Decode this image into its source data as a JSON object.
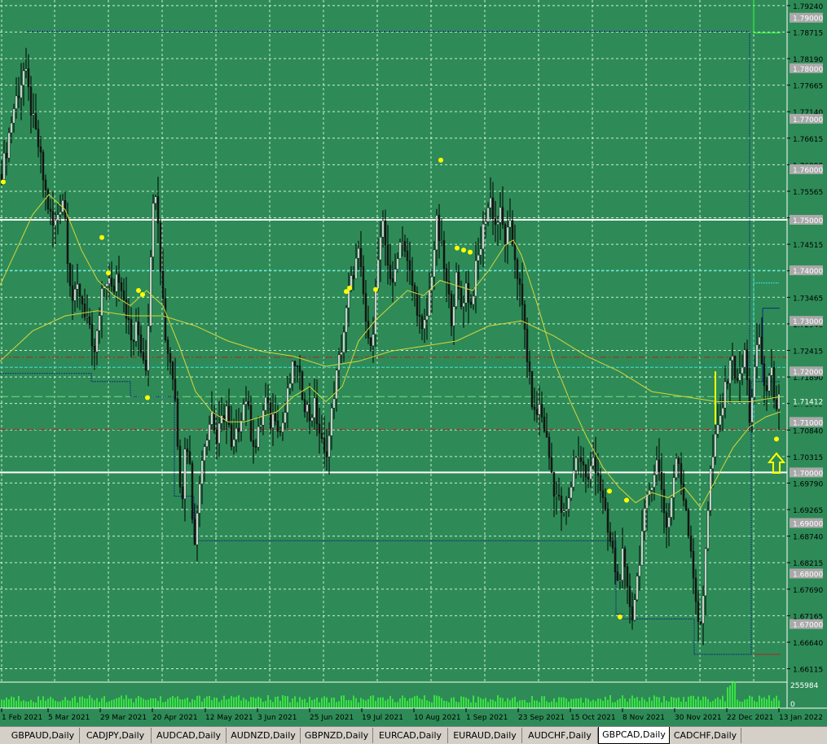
{
  "chart_data": {
    "type": "candlestick",
    "symbol_tab": "GBPCAD,Daily",
    "colors": {
      "background": "#2e8b57",
      "grid": "#e6ffe6",
      "bull_body": "#ffffff",
      "bear_body": "#1a1a1a",
      "wick": "#000000",
      "ma_fast": "#d6d63a",
      "ma_slow": "#d6d63a",
      "channel": "#102a7a",
      "level_white": "#ffffff",
      "level_red": "#b22222",
      "level_cyan": "#40e0e0",
      "fractal": "#ffff00",
      "volume": "#3cff3c",
      "axis_text": "#000000",
      "axis_box": "#a9a9a9"
    },
    "ylim": [
      1.6585,
      1.7935
    ],
    "y_ticks": [
      "1.79240",
      "1.78715",
      "1.78190",
      "1.77665",
      "1.77140",
      "1.76615",
      "1.76090",
      "1.75565",
      "1.75040",
      "1.74515",
      "1.73990",
      "1.73465",
      "1.72940",
      "1.72415",
      "1.71890",
      "1.71365",
      "1.70840",
      "1.70315",
      "1.69790",
      "1.69265",
      "1.68740",
      "1.68215",
      "1.67690",
      "1.67165",
      "1.66640",
      "1.66115"
    ],
    "round_levels": [
      "1.79000",
      "1.78000",
      "1.77000",
      "1.76000",
      "1.75000",
      "1.74000",
      "1.73000",
      "1.72000",
      "1.71000",
      "1.70000",
      "1.69000",
      "1.68000",
      "1.67000"
    ],
    "current_price": "1.71412",
    "volume_labels": [
      "255984",
      "0"
    ],
    "x_labels": [
      "1 Feb 2021",
      "5 Mar 2021",
      "29 Mar 2021",
      "20 Apr 2021",
      "12 May 2021",
      "3 Jun 2021",
      "25 Jun 2021",
      "19 Jul 2021",
      "10 Aug 2021",
      "1 Sep 2021",
      "23 Sep 2021",
      "15 Oct 2021",
      "8 Nov 2021",
      "30 Nov 2021",
      "22 Dec 2021",
      "13 Jan 2022"
    ],
    "close_path": [
      [
        0,
        1.759
      ],
      [
        6,
        1.762
      ],
      [
        12,
        1.768
      ],
      [
        18,
        1.773
      ],
      [
        24,
        1.776
      ],
      [
        30,
        1.78
      ],
      [
        36,
        1.774
      ],
      [
        42,
        1.768
      ],
      [
        48,
        1.764
      ],
      [
        54,
        1.757
      ],
      [
        60,
        1.752
      ],
      [
        66,
        1.748
      ],
      [
        72,
        1.752
      ],
      [
        78,
        1.755
      ],
      [
        84,
        1.741
      ],
      [
        90,
        1.733
      ],
      [
        96,
        1.737
      ],
      [
        102,
        1.733
      ],
      [
        108,
        1.73
      ],
      [
        114,
        1.722
      ],
      [
        120,
        1.728
      ],
      [
        126,
        1.736
      ],
      [
        132,
        1.739
      ],
      [
        138,
        1.735
      ],
      [
        144,
        1.74
      ],
      [
        150,
        1.737
      ],
      [
        156,
        1.731
      ],
      [
        162,
        1.725
      ],
      [
        168,
        1.729
      ],
      [
        174,
        1.724
      ],
      [
        180,
        1.721
      ],
      [
        186,
        1.749
      ],
      [
        192,
        1.758
      ],
      [
        196,
        1.744
      ],
      [
        200,
        1.734
      ],
      [
        204,
        1.725
      ],
      [
        210,
        1.722
      ],
      [
        216,
        1.713
      ],
      [
        220,
        1.7
      ],
      [
        224,
        1.696
      ],
      [
        228,
        1.707
      ],
      [
        232,
        1.704
      ],
      [
        236,
        1.692
      ],
      [
        240,
        1.686
      ],
      [
        244,
        1.696
      ],
      [
        248,
        1.704
      ],
      [
        254,
        1.708
      ],
      [
        260,
        1.712
      ],
      [
        266,
        1.706
      ],
      [
        272,
        1.71
      ],
      [
        278,
        1.713
      ],
      [
        284,
        1.704
      ],
      [
        290,
        1.707
      ],
      [
        296,
        1.712
      ],
      [
        302,
        1.715
      ],
      [
        308,
        1.708
      ],
      [
        314,
        1.705
      ],
      [
        320,
        1.71
      ],
      [
        326,
        1.714
      ],
      [
        332,
        1.71
      ],
      [
        338,
        1.712
      ],
      [
        344,
        1.708
      ],
      [
        350,
        1.712
      ],
      [
        356,
        1.718
      ],
      [
        362,
        1.722
      ],
      [
        368,
        1.718
      ],
      [
        374,
        1.714
      ],
      [
        380,
        1.711
      ],
      [
        386,
        1.713
      ],
      [
        392,
        1.708
      ],
      [
        398,
        1.703
      ],
      [
        404,
        1.707
      ],
      [
        410,
        1.716
      ],
      [
        416,
        1.722
      ],
      [
        422,
        1.728
      ],
      [
        428,
        1.735
      ],
      [
        434,
        1.74
      ],
      [
        440,
        1.743
      ],
      [
        446,
        1.735
      ],
      [
        452,
        1.725
      ],
      [
        458,
        1.729
      ],
      [
        464,
        1.742
      ],
      [
        470,
        1.748
      ],
      [
        476,
        1.742
      ],
      [
        482,
        1.736
      ],
      [
        488,
        1.744
      ],
      [
        494,
        1.747
      ],
      [
        500,
        1.741
      ],
      [
        506,
        1.737
      ],
      [
        512,
        1.733
      ],
      [
        518,
        1.727
      ],
      [
        524,
        1.731
      ],
      [
        530,
        1.74
      ],
      [
        536,
        1.749
      ],
      [
        542,
        1.744
      ],
      [
        548,
        1.737
      ],
      [
        554,
        1.731
      ],
      [
        560,
        1.738
      ],
      [
        566,
        1.733
      ],
      [
        572,
        1.737
      ],
      [
        578,
        1.733
      ],
      [
        584,
        1.74
      ],
      [
        590,
        1.745
      ],
      [
        596,
        1.751
      ],
      [
        602,
        1.754
      ],
      [
        608,
        1.749
      ],
      [
        614,
        1.751
      ],
      [
        620,
        1.746
      ],
      [
        626,
        1.748
      ],
      [
        632,
        1.743
      ],
      [
        638,
        1.736
      ],
      [
        644,
        1.728
      ],
      [
        650,
        1.718
      ],
      [
        656,
        1.711
      ],
      [
        662,
        1.713
      ],
      [
        668,
        1.709
      ],
      [
        674,
        1.703
      ],
      [
        680,
        1.697
      ],
      [
        686,
        1.694
      ],
      [
        692,
        1.691
      ],
      [
        698,
        1.694
      ],
      [
        704,
        1.701
      ],
      [
        710,
        1.704
      ],
      [
        716,
        1.701
      ],
      [
        722,
        1.698
      ],
      [
        728,
        1.703
      ],
      [
        734,
        1.7
      ],
      [
        740,
        1.694
      ],
      [
        746,
        1.688
      ],
      [
        752,
        1.684
      ],
      [
        758,
        1.678
      ],
      [
        764,
        1.683
      ],
      [
        770,
        1.676
      ],
      [
        776,
        1.672
      ],
      [
        782,
        1.679
      ],
      [
        788,
        1.688
      ],
      [
        794,
        1.694
      ],
      [
        800,
        1.699
      ],
      [
        806,
        1.702
      ],
      [
        812,
        1.697
      ],
      [
        818,
        1.689
      ],
      [
        824,
        1.695
      ],
      [
        830,
        1.703
      ],
      [
        836,
        1.698
      ],
      [
        842,
        1.693
      ],
      [
        848,
        1.685
      ],
      [
        854,
        1.675
      ],
      [
        858,
        1.667
      ],
      [
        862,
        1.673
      ],
      [
        866,
        1.686
      ],
      [
        872,
        1.7
      ],
      [
        878,
        1.706
      ],
      [
        884,
        1.711
      ],
      [
        890,
        1.716
      ],
      [
        896,
        1.723
      ],
      [
        902,
        1.72
      ],
      [
        908,
        1.718
      ],
      [
        914,
        1.724
      ],
      [
        920,
        1.711
      ],
      [
        926,
        1.72
      ],
      [
        932,
        1.727
      ],
      [
        936,
        1.719
      ],
      [
        940,
        1.716
      ],
      [
        946,
        1.72
      ],
      [
        952,
        1.714
      ],
      [
        958,
        1.714
      ]
    ],
    "ma_fast_path": [
      [
        0,
        1.737
      ],
      [
        20,
        1.744
      ],
      [
        40,
        1.751
      ],
      [
        60,
        1.755
      ],
      [
        80,
        1.752
      ],
      [
        100,
        1.744
      ],
      [
        120,
        1.738
      ],
      [
        140,
        1.735
      ],
      [
        160,
        1.733
      ],
      [
        180,
        1.736
      ],
      [
        200,
        1.733
      ],
      [
        220,
        1.725
      ],
      [
        240,
        1.716
      ],
      [
        260,
        1.712
      ],
      [
        280,
        1.71
      ],
      [
        300,
        1.71
      ],
      [
        320,
        1.711
      ],
      [
        340,
        1.712
      ],
      [
        360,
        1.715
      ],
      [
        380,
        1.717
      ],
      [
        400,
        1.714
      ],
      [
        420,
        1.717
      ],
      [
        440,
        1.726
      ],
      [
        460,
        1.73
      ],
      [
        480,
        1.733
      ],
      [
        500,
        1.736
      ],
      [
        520,
        1.735
      ],
      [
        540,
        1.738
      ],
      [
        560,
        1.737
      ],
      [
        580,
        1.736
      ],
      [
        600,
        1.74
      ],
      [
        620,
        1.745
      ],
      [
        630,
        1.746
      ],
      [
        640,
        1.743
      ],
      [
        660,
        1.733
      ],
      [
        680,
        1.722
      ],
      [
        700,
        1.714
      ],
      [
        720,
        1.707
      ],
      [
        740,
        1.701
      ],
      [
        760,
        1.697
      ],
      [
        780,
        1.694
      ],
      [
        800,
        1.696
      ],
      [
        820,
        1.695
      ],
      [
        840,
        1.697
      ],
      [
        860,
        1.693
      ],
      [
        880,
        1.699
      ],
      [
        900,
        1.705
      ],
      [
        920,
        1.709
      ],
      [
        940,
        1.711
      ],
      [
        958,
        1.712
      ]
    ],
    "ma_slow_path": [
      [
        0,
        1.722
      ],
      [
        40,
        1.728
      ],
      [
        80,
        1.731
      ],
      [
        120,
        1.732
      ],
      [
        160,
        1.731
      ],
      [
        200,
        1.731
      ],
      [
        240,
        1.729
      ],
      [
        280,
        1.726
      ],
      [
        320,
        1.724
      ],
      [
        360,
        1.723
      ],
      [
        400,
        1.721
      ],
      [
        440,
        1.722
      ],
      [
        480,
        1.724
      ],
      [
        520,
        1.725
      ],
      [
        560,
        1.726
      ],
      [
        600,
        1.729
      ],
      [
        640,
        1.73
      ],
      [
        680,
        1.727
      ],
      [
        720,
        1.723
      ],
      [
        760,
        1.72
      ],
      [
        800,
        1.716
      ],
      [
        840,
        1.715
      ],
      [
        880,
        1.714
      ],
      [
        920,
        1.714
      ],
      [
        958,
        1.715
      ]
    ],
    "fractals": [
      [
        4,
        1.7575
      ],
      [
        125,
        1.7465
      ],
      [
        133,
        1.7395
      ],
      [
        170,
        1.736
      ],
      [
        175,
        1.7352
      ],
      [
        181,
        1.7148
      ],
      [
        425,
        1.7358
      ],
      [
        429,
        1.7365
      ],
      [
        461,
        1.7362
      ],
      [
        541,
        1.7618
      ],
      [
        561,
        1.7444
      ],
      [
        569,
        1.744
      ],
      [
        577,
        1.7436
      ],
      [
        748,
        1.6963
      ],
      [
        769,
        1.6945
      ],
      [
        761,
        1.6714
      ],
      [
        953,
        1.7066
      ]
    ],
    "horizontal_levels": [
      {
        "price": 1.75,
        "style": "white"
      },
      {
        "price": 1.7,
        "style": "white"
      },
      {
        "price": 1.7228,
        "style": "red"
      },
      {
        "price": 1.7085,
        "style": "red"
      },
      {
        "price": 1.74,
        "style": "cyan"
      },
      {
        "price": 1.7208,
        "style": "cyan"
      },
      {
        "price": 1.715,
        "style": "green"
      }
    ],
    "channel_path": [
      [
        0,
        1.7196
      ],
      [
        112,
        1.7196
      ],
      [
        112,
        1.718
      ],
      [
        160,
        1.718
      ],
      [
        160,
        1.715
      ],
      [
        214,
        1.715
      ],
      [
        214,
        1.6953
      ],
      [
        238,
        1.6953
      ],
      [
        238,
        1.6865
      ],
      [
        697,
        1.6865
      ],
      [
        756,
        1.6865
      ],
      [
        756,
        1.672
      ],
      [
        764,
        1.672
      ],
      [
        764,
        1.671
      ],
      [
        852,
        1.671
      ],
      [
        852,
        1.664
      ],
      [
        922,
        1.664
      ],
      [
        922,
        1.718
      ],
      [
        958,
        1.718
      ]
    ],
    "channel_top_path": [
      [
        33,
        1.7873
      ],
      [
        920,
        1.7873
      ],
      [
        920,
        1.718
      ]
    ]
  },
  "tabs": [
    "GBPAUD,Daily",
    "CADJPY,Daily",
    "AUDCAD,Daily",
    "AUDNZD,Daily",
    "GBPNZD,Daily",
    "EURCAD,Daily",
    "EURAUD,Daily",
    "AUDCHF,Daily",
    "GBPCAD,Daily",
    "CADCHF,Daily"
  ],
  "active_tab": "GBPCAD,Daily"
}
